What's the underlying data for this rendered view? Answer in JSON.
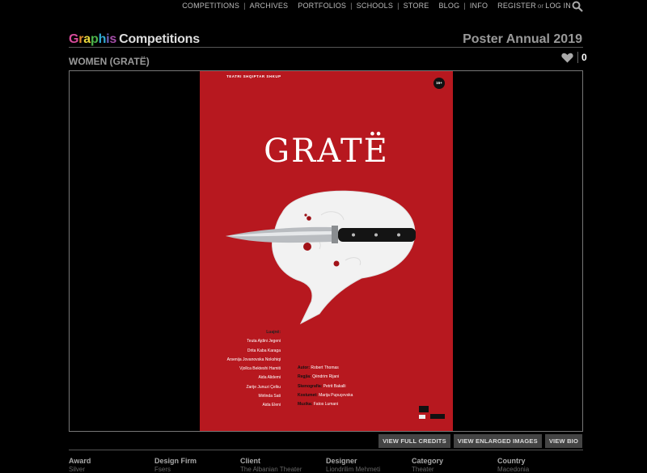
{
  "nav": {
    "items": [
      "COMPETITIONS",
      "ARCHIVES",
      "PORTFOLIOS",
      "SCHOOLS",
      "STORE",
      "BLOG",
      "INFO",
      "REGISTER",
      "or",
      "LOG IN"
    ]
  },
  "brand": {
    "graphis": "Graphis",
    "competitions": "Competitions"
  },
  "annual": "Poster Annual 2019",
  "entry": {
    "title": "WOMEN (GRATË)",
    "likes": "0"
  },
  "poster": {
    "theatre": "TEATRI SHQIPTAR SHKUP",
    "age": "16+",
    "title": "GRATË",
    "cast_label": "Luajnë:",
    "cast": [
      "Teuta Ajdini Jegeni",
      "Drita Kaba Karaga",
      "Arsenija Jovanovska Nokshiqi",
      "Vjollca Bekteshi Hamiti",
      "Aida Alidemi",
      "Zarije Junuzi Çelku",
      "Mirlinda Sati",
      "Aida Eleni"
    ],
    "crew": [
      {
        "k": "Autor:",
        "v": "Robert Thomas"
      },
      {
        "k": "Regjia:",
        "v": "Qëndrim Rijani"
      },
      {
        "k": "Skenografia:",
        "v": "Petrit Bakalli"
      },
      {
        "k": "Kostumet:",
        "v": "Marija Pupuçevska"
      },
      {
        "k": "Muzika:",
        "v": "Fatos Lumani"
      }
    ]
  },
  "buttons": {
    "credits": "VIEW FULL CREDITS",
    "enlarged": "VIEW ENLARGED IMAGES",
    "bio": "VIEW BIO"
  },
  "meta": [
    {
      "h": "Award",
      "v": "Silver"
    },
    {
      "h": "Design Firm",
      "v": "Fsers"
    },
    {
      "h": "Client",
      "v": "The Albanian Theater"
    },
    {
      "h": "Designer",
      "v": "Liondrilim Mehmeti"
    },
    {
      "h": "Category",
      "v": "Theater"
    },
    {
      "h": "Country",
      "v": "Macedonia"
    }
  ]
}
